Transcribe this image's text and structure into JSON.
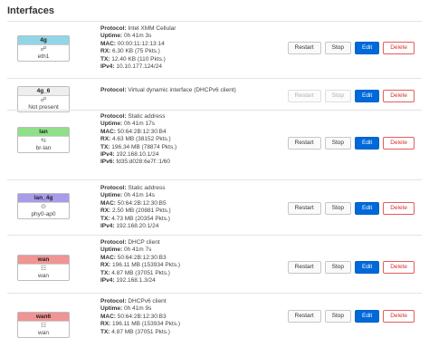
{
  "page": {
    "title": "Interfaces"
  },
  "buttons": {
    "restart": "Restart",
    "stop": "Stop",
    "edit": "Edit",
    "delete": "Delete"
  },
  "interfaces": [
    {
      "name": "4g",
      "header_color": "#90d6e8",
      "icon": "cellular-icon",
      "device": "eth1",
      "disabled_actions": false,
      "details": [
        {
          "label": "Protocol:",
          "value": "Intel XMM Cellular"
        },
        {
          "label": "Uptime:",
          "value": "0h 41m 3s"
        },
        {
          "label": "MAC:",
          "value": "00:00:11:12:13:14"
        },
        {
          "label": "RX:",
          "value": "6.30 KB (75 Pkts.)"
        },
        {
          "label": "TX:",
          "value": "12.40 KB (110 Pkts.)"
        },
        {
          "label": "IPv4:",
          "value": "10.10.177.124/24"
        }
      ]
    },
    {
      "name": "4g_6",
      "header_color": "#eeeeee",
      "icon": "cellular-icon",
      "device": "Not present",
      "disabled_actions": true,
      "details": [
        {
          "label": "Protocol:",
          "value": "Virtual dynamic interface (DHCPv6 client)"
        }
      ]
    },
    {
      "name": "lan",
      "header_color": "#90e08a",
      "icon": "bridge-icon",
      "device": "br-lan",
      "disabled_actions": false,
      "details": [
        {
          "label": "Protocol:",
          "value": "Static address"
        },
        {
          "label": "Uptime:",
          "value": "0h 41m 17s"
        },
        {
          "label": "MAC:",
          "value": "50:64:2B:12:30:B4"
        },
        {
          "label": "RX:",
          "value": "4.63 MB (38152 Pkts.)"
        },
        {
          "label": "TX:",
          "value": "196.34 MB (78874 Pkts.)"
        },
        {
          "label": "IPv4:",
          "value": "192.168.10.1/24"
        },
        {
          "label": "IPv6:",
          "value": "fd35:d028:6e7f::1/60"
        }
      ]
    },
    {
      "name": "lan_4g",
      "header_color": "#a99bea",
      "icon": "wireless-icon",
      "device": "phy0-ap0",
      "disabled_actions": false,
      "details": [
        {
          "label": "Protocol:",
          "value": "Static address"
        },
        {
          "label": "Uptime:",
          "value": "0h 41m 14s"
        },
        {
          "label": "MAC:",
          "value": "50:64:2B:12:30:B5"
        },
        {
          "label": "RX:",
          "value": "2.50 MB (20881 Pkts.)"
        },
        {
          "label": "TX:",
          "value": "4.73 MB (20354 Pkts.)"
        },
        {
          "label": "IPv4:",
          "value": "192.168.20.1/24"
        }
      ]
    },
    {
      "name": "wan",
      "header_color": "#f09494",
      "icon": "ethernet-icon",
      "device": "wan",
      "disabled_actions": false,
      "details": [
        {
          "label": "Protocol:",
          "value": "DHCP client"
        },
        {
          "label": "Uptime:",
          "value": "0h 41m 7s"
        },
        {
          "label": "MAC:",
          "value": "50:64:2B:12:30:B3"
        },
        {
          "label": "RX:",
          "value": "196.11 MB (153934 Pkts.)"
        },
        {
          "label": "TX:",
          "value": "4.87 MB (37051 Pkts.)"
        },
        {
          "label": "IPv4:",
          "value": "192.168.1.3/24"
        }
      ]
    },
    {
      "name": "wan6",
      "header_color": "#f09494",
      "icon": "ethernet-icon",
      "device": "wan",
      "disabled_actions": false,
      "details": [
        {
          "label": "Protocol:",
          "value": "DHCPv6 client"
        },
        {
          "label": "Uptime:",
          "value": "0h 41m 9s"
        },
        {
          "label": "MAC:",
          "value": "50:64:2B:12:30:B3"
        },
        {
          "label": "RX:",
          "value": "196.11 MB (153934 Pkts.)"
        },
        {
          "label": "TX:",
          "value": "4.87 MB (37051 Pkts.)"
        }
      ]
    }
  ]
}
